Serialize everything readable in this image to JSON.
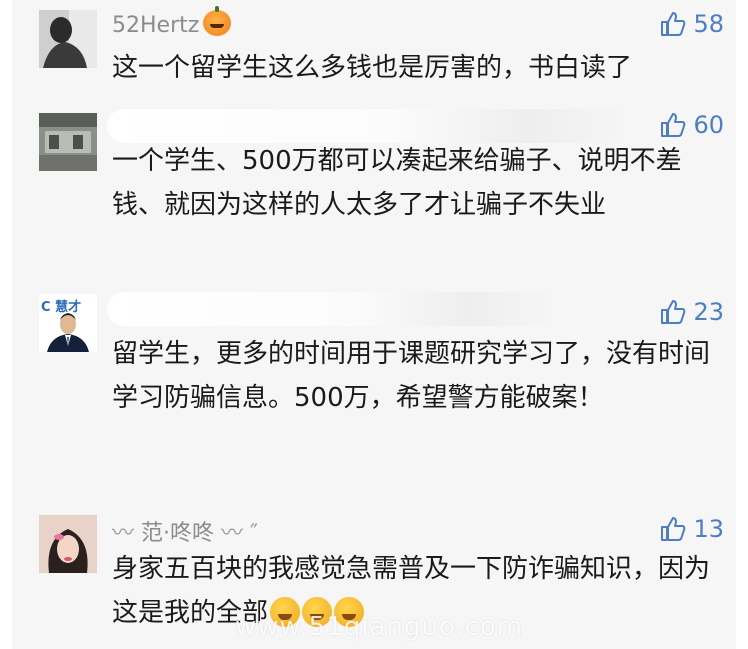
{
  "comments": [
    {
      "username": "52Hertz",
      "likes": "58",
      "text": "这一个留学生这么多钱也是厉害的，书白读了"
    },
    {
      "username": "",
      "likes": "60",
      "text": "一个学生、500万都可以凑起来给骗子、说明不差钱、就因为这样的人太多了才让骗子不失业"
    },
    {
      "username": "",
      "avatar_label": "C 慧才",
      "likes": "23",
      "text": "留学生，更多的时间用于课题研究学习了，没有时间学习防骗信息。500万，希望警方能破案！"
    },
    {
      "username": "范·咚咚",
      "likes": "13",
      "text": "身家五百块的我感觉急需普及一下防诈骗知识，因为这是我的全部"
    }
  ],
  "watermark": "www.51qianguo.com",
  "colors": {
    "like": "#4d7ec3",
    "text": "#1a1a1a",
    "name": "#8c8c8c"
  }
}
